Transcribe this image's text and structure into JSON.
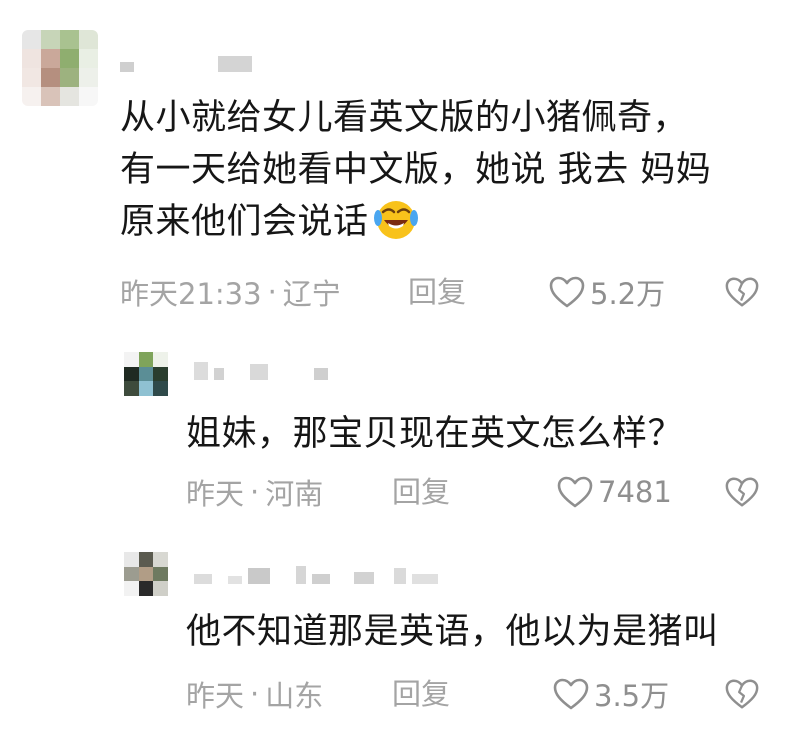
{
  "comments": [
    {
      "lines": [
        "从小就给女儿看英文版的小猪佩奇，",
        "有一天给她看中文版，她说 我去 妈妈",
        "原来他们会说话"
      ],
      "emoji": "laughing-crying-emoji",
      "time": "昨天21:33",
      "location": "辽宁",
      "reply_label": "回复",
      "likes": "5.2万"
    },
    {
      "lines": [
        "姐妹，那宝贝现在英文怎么样？"
      ],
      "time": "昨天",
      "location": "河南",
      "reply_label": "回复",
      "likes": "7481"
    },
    {
      "lines": [
        "他不知道那是英语，他以为是猪叫"
      ],
      "time": "昨天",
      "location": "山东",
      "reply_label": "回复",
      "likes": "3.5万"
    }
  ],
  "separator": "·",
  "icons": {
    "like": "heart-outline-icon",
    "dislike": "broken-heart-icon"
  },
  "colors": {
    "text": "#161616",
    "meta": "#a4a4a4",
    "count": "#8f8f8f"
  }
}
